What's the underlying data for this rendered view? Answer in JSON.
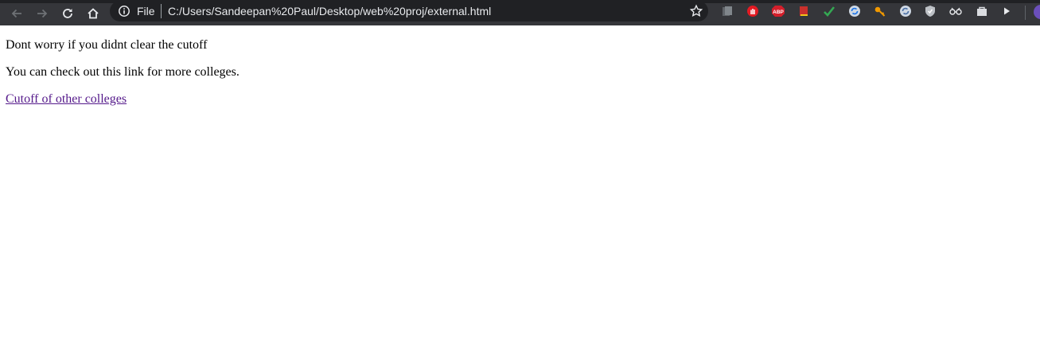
{
  "browser": {
    "scheme_label": "File",
    "url": "C:/Users/Sandeepan%20Paul/Desktop/web%20proj/external.html",
    "icons": [
      "back-icon",
      "forward-icon",
      "reload-icon",
      "home-icon",
      "info-icon",
      "star-icon"
    ],
    "extensions": [
      "extension-icon-1",
      "adblock-red-icon",
      "abp-icon",
      "book-icon",
      "check-icon",
      "sync-icon",
      "key-icon",
      "sync-icon-2",
      "shield-icon",
      "glasses-icon",
      "bag-icon",
      "play-icon"
    ],
    "colors": {
      "toolbar": "#35363a",
      "omnibox": "#202124",
      "text": "#e8eaed"
    }
  },
  "page": {
    "line1": "Dont worry if you didnt clear the cutoff",
    "line2": "You can check out this link for more colleges.",
    "link_text": "Cutoff of other colleges",
    "colors": {
      "text": "#000000",
      "visited_link": "#551a8b"
    }
  }
}
